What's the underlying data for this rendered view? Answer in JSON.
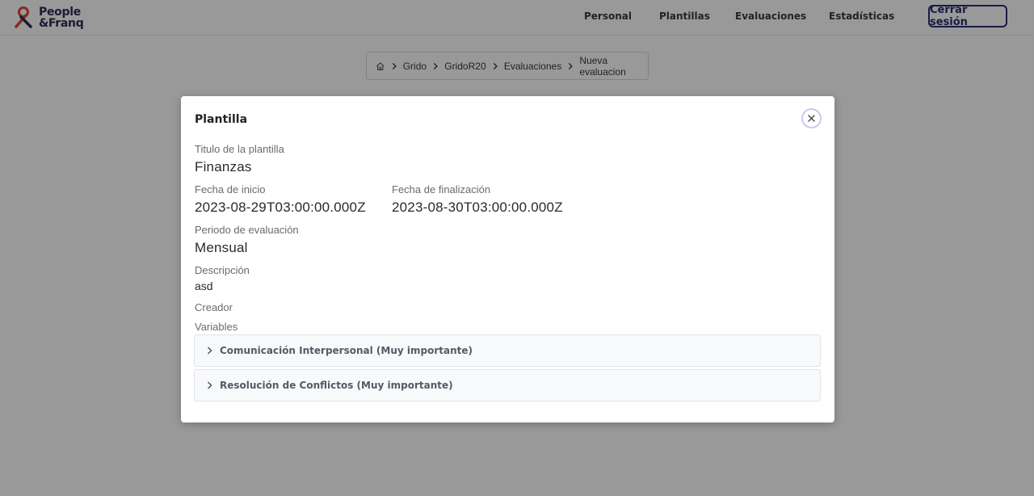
{
  "brand": {
    "line1": "People",
    "line2": "&Franq",
    "mark_color": "#e0473a"
  },
  "nav": {
    "personal": "Personal",
    "plantillas": "Plantillas",
    "evaluaciones": "Evaluaciones",
    "estadisticas": "Estadísticas",
    "logout": "Cerrar sesión"
  },
  "breadcrumb": {
    "home_icon": "home-icon",
    "items": [
      "Grido",
      "GridoR20",
      "Evaluaciones",
      "Nueva evaluacion"
    ]
  },
  "modal": {
    "title": "Plantilla",
    "close_icon": "close-icon",
    "titulo_label": "Titulo de la plantilla",
    "titulo_value": "Finanzas",
    "fecha_inicio_label": "Fecha de inicio",
    "fecha_inicio_value": "2023-08-29T03:00:00.000Z",
    "fecha_fin_label": "Fecha de finalización",
    "fecha_fin_value": "2023-08-30T03:00:00.000Z",
    "periodo_label": "Periodo de evaluación",
    "periodo_value": "Mensual",
    "descripcion_label": "Descripción",
    "descripcion_value": "asd",
    "creador_label": "Creador",
    "variables_label": "Variables",
    "variables": [
      "Comunicación Interpersonal (Muy importante)",
      "Resolución de Conflictos (Muy importante)"
    ]
  },
  "colors": {
    "accent": "#2b2d6e",
    "overlay": "rgba(0,0,0,0.40)"
  }
}
